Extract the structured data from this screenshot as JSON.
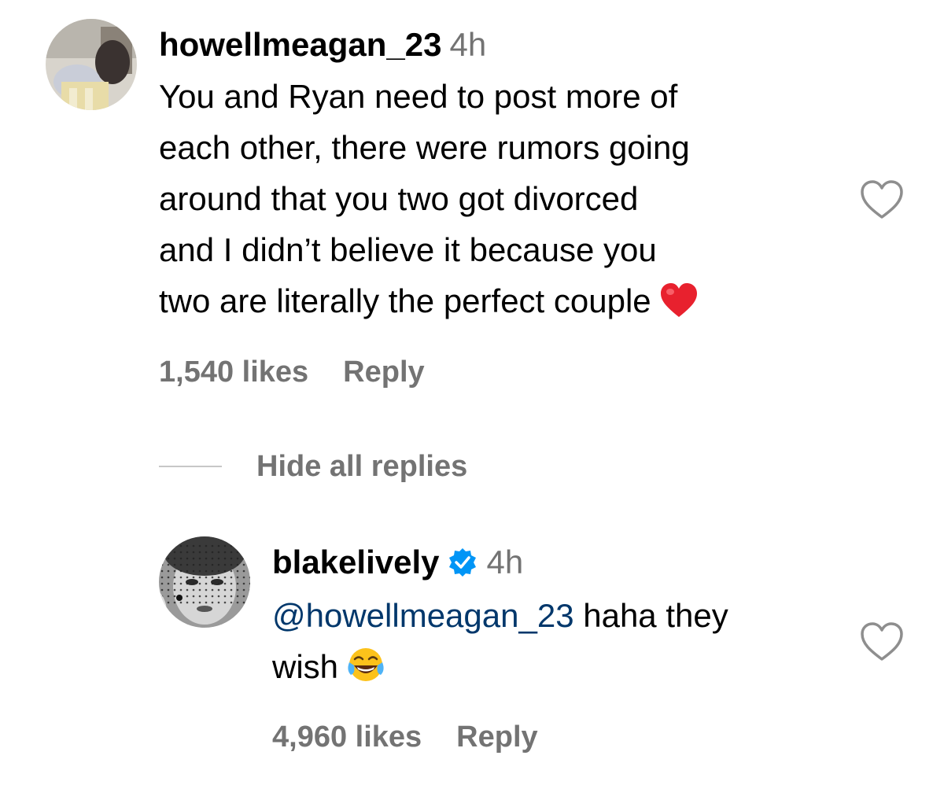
{
  "comment": {
    "username": "howellmeagan_23",
    "timestamp": "4h",
    "text": "You and Ryan need to post more of each other, there were rumors going around that you two got divorced and I didn't believe it because you two are literally the perfect couple",
    "text_lines": [
      "You and Ryan need to post more of",
      "each other, there were rumors going",
      "around that you two got divorced",
      "and I didn’t believe it because you",
      "two are literally the perfect couple"
    ],
    "emoji": "red-heart-emoji",
    "likes": "1,540 likes",
    "reply_label": "Reply",
    "like_icon": "heart-outline-icon"
  },
  "replies_toggle": {
    "label": "Hide all replies"
  },
  "reply": {
    "username": "blakelively",
    "verified": true,
    "verified_icon": "verified-badge-icon",
    "timestamp": "4h",
    "mention": "@howellmeagan_23",
    "text_after_mention_line1": " haha they",
    "text_line2": "wish",
    "emoji": "face-with-tears-of-joy-emoji",
    "likes": "4,960 likes",
    "reply_label": "Reply",
    "like_icon": "heart-outline-icon"
  },
  "colors": {
    "text": "#000000",
    "muted": "#737373",
    "mention": "#00376b",
    "verified_blue": "#0095f6",
    "divider": "#c7c7c7"
  }
}
